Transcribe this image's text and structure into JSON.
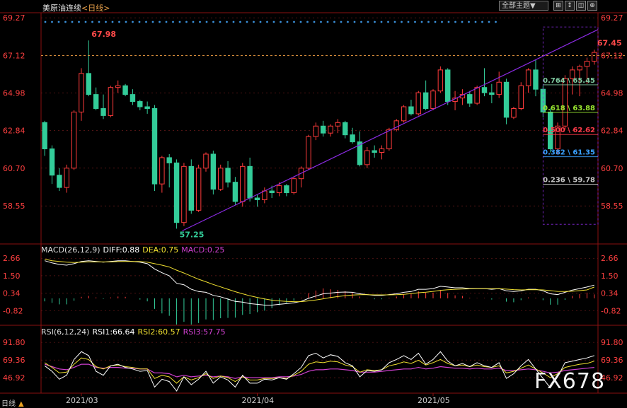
{
  "header": {
    "instrument": "美原油连续",
    "period": "<日线>",
    "theme_button": "全部主题▼",
    "tool_buttons": [
      "⊞",
      "↕",
      "◫",
      "⊕"
    ]
  },
  "colors": {
    "up": "#ff3b3b",
    "down": "#33cc99",
    "gridline": "#802020",
    "trend": "#8a2be2",
    "macd_diff": "#ffffff",
    "macd_dea": "#f0e030",
    "rsi1": "#ffffff",
    "rsi2": "#f0e030",
    "rsi3": "#d040d0",
    "axis_text": "#ff4040",
    "dot_row": "#3a8fd8"
  },
  "macd": {
    "label": "MACD(26,12,9)",
    "diff": "DIFF:0.88",
    "dea": "DEA:0.75",
    "macd": "MACD:0.25"
  },
  "rsi": {
    "label": "RSI(6,12,24)",
    "rsi1": "RSI1:66.64",
    "rsi2": "RSI2:60.57",
    "rsi3": "RSI3:57.75"
  },
  "bottom": {
    "side_label": "日线",
    "watermark": "FX678"
  },
  "chart_data": {
    "type": "candlestick",
    "x_labels": [
      "2021/03",
      "2021/04",
      "2021/05"
    ],
    "price_axis": [
      "69.27",
      "67.12",
      "64.98",
      "62.84",
      "60.70",
      "58.55"
    ],
    "ylim": [
      56.5,
      69.4
    ],
    "current_price": 67.12,
    "high_marker": {
      "label": "67.98",
      "value": 67.98
    },
    "low_marker": {
      "label": "57.25",
      "value": 57.25
    },
    "last_marker": {
      "label": "67.45",
      "value": 67.45
    },
    "fib_levels": [
      {
        "label": "0.764 \\ 65.45",
        "value": 65.45,
        "color": "#7fc9a0"
      },
      {
        "label": "0.618 \\ 63.88",
        "value": 63.88,
        "color": "#9be830"
      },
      {
        "label": "0.500 \\ 62.62",
        "value": 62.62,
        "color": "#ff3b4a"
      },
      {
        "label": "0.382 \\ 61.35",
        "value": 61.35,
        "color": "#3aa0ff"
      },
      {
        "label": "0.236 \\ 59.78",
        "value": 59.78,
        "color": "#c8c8c8"
      }
    ],
    "candles": [
      [
        63.3,
        63.4,
        61.4,
        61.8
      ],
      [
        61.8,
        62.0,
        59.8,
        60.3
      ],
      [
        60.3,
        60.7,
        59.4,
        59.6
      ],
      [
        59.6,
        60.9,
        59.3,
        60.7
      ],
      [
        60.7,
        64.0,
        60.6,
        63.9
      ],
      [
        63.9,
        66.4,
        63.4,
        66.1
      ],
      [
        66.1,
        67.98,
        64.8,
        64.9
      ],
      [
        64.9,
        65.3,
        64.0,
        64.1
      ],
      [
        64.1,
        64.9,
        63.5,
        63.7
      ],
      [
        63.7,
        65.4,
        63.6,
        65.3
      ],
      [
        65.3,
        65.7,
        65.0,
        65.4
      ],
      [
        65.4,
        65.5,
        64.8,
        64.9
      ],
      [
        64.9,
        65.2,
        64.3,
        64.5
      ],
      [
        64.5,
        64.6,
        64.0,
        64.2
      ],
      [
        64.2,
        64.5,
        63.8,
        64.1
      ],
      [
        64.1,
        64.3,
        59.4,
        59.8
      ],
      [
        59.8,
        61.4,
        59.3,
        61.3
      ],
      [
        61.3,
        61.5,
        59.6,
        61.0
      ],
      [
        61.0,
        61.2,
        57.25,
        57.6
      ],
      [
        57.6,
        61.0,
        57.4,
        60.8
      ],
      [
        60.8,
        61.2,
        58.1,
        58.3
      ],
      [
        58.3,
        60.9,
        58.2,
        60.7
      ],
      [
        60.7,
        61.6,
        60.5,
        61.5
      ],
      [
        61.5,
        61.7,
        59.2,
        59.5
      ],
      [
        59.5,
        60.9,
        59.4,
        60.7
      ],
      [
        60.7,
        61.1,
        59.6,
        59.9
      ],
      [
        59.9,
        60.2,
        58.6,
        58.8
      ],
      [
        58.8,
        61.0,
        58.5,
        60.8
      ],
      [
        60.8,
        61.3,
        58.8,
        59.0
      ],
      [
        59.0,
        59.2,
        58.5,
        58.9
      ],
      [
        58.9,
        59.6,
        58.7,
        59.4
      ],
      [
        59.4,
        59.7,
        59.0,
        59.3
      ],
      [
        59.3,
        59.9,
        59.1,
        59.7
      ],
      [
        59.7,
        59.8,
        59.1,
        59.3
      ],
      [
        59.3,
        60.2,
        59.2,
        60.1
      ],
      [
        60.1,
        60.8,
        59.6,
        60.7
      ],
      [
        60.7,
        62.6,
        60.6,
        62.5
      ],
      [
        62.5,
        63.3,
        62.3,
        63.1
      ],
      [
        63.1,
        63.4,
        62.5,
        62.7
      ],
      [
        62.7,
        63.2,
        62.5,
        63.1
      ],
      [
        63.1,
        63.5,
        62.7,
        63.3
      ],
      [
        63.3,
        63.4,
        62.4,
        62.6
      ],
      [
        62.6,
        63.0,
        62.1,
        62.2
      ],
      [
        62.2,
        62.8,
        60.8,
        60.9
      ],
      [
        60.9,
        61.9,
        60.7,
        61.7
      ],
      [
        61.7,
        62.0,
        61.3,
        61.6
      ],
      [
        61.6,
        62.0,
        61.2,
        61.8
      ],
      [
        61.8,
        63.0,
        61.7,
        62.9
      ],
      [
        62.9,
        63.5,
        62.8,
        63.4
      ],
      [
        63.4,
        64.3,
        63.3,
        64.2
      ],
      [
        64.2,
        64.6,
        63.7,
        63.8
      ],
      [
        63.8,
        65.1,
        63.7,
        65.0
      ],
      [
        65.0,
        65.7,
        64.0,
        64.1
      ],
      [
        64.1,
        65.2,
        64.0,
        65.1
      ],
      [
        65.1,
        66.5,
        65.0,
        66.3
      ],
      [
        66.3,
        66.4,
        64.3,
        64.5
      ],
      [
        64.5,
        65.1,
        64.0,
        64.7
      ],
      [
        64.7,
        65.2,
        64.3,
        64.9
      ],
      [
        64.9,
        65.1,
        64.2,
        64.4
      ],
      [
        64.4,
        65.4,
        64.3,
        65.3
      ],
      [
        65.3,
        66.4,
        64.8,
        65.0
      ],
      [
        65.0,
        65.5,
        64.4,
        64.9
      ],
      [
        64.9,
        66.2,
        64.7,
        65.6
      ],
      [
        65.6,
        65.8,
        63.2,
        63.6
      ],
      [
        63.6,
        64.2,
        63.5,
        64.1
      ],
      [
        64.1,
        65.6,
        64.0,
        65.4
      ],
      [
        65.4,
        66.4,
        65.0,
        66.3
      ],
      [
        66.3,
        66.9,
        64.8,
        65.2
      ],
      [
        65.2,
        65.4,
        63.6,
        63.9
      ],
      [
        63.9,
        64.1,
        61.6,
        61.8
      ],
      [
        61.8,
        63.3,
        61.5,
        63.1
      ],
      [
        63.1,
        66.0,
        62.9,
        65.8
      ],
      [
        65.8,
        66.5,
        64.9,
        66.3
      ],
      [
        66.3,
        66.6,
        64.8,
        66.5
      ],
      [
        66.5,
        67.0,
        65.5,
        66.8
      ],
      [
        66.8,
        67.45,
        66.6,
        67.3
      ]
    ],
    "macd_axis": [
      "2.66",
      "1.50",
      "0.34",
      "-0.82"
    ],
    "macd_ylim": [
      -1.6,
      3.0
    ],
    "macd_diff": [
      2.5,
      2.35,
      2.25,
      2.2,
      2.3,
      2.45,
      2.5,
      2.45,
      2.4,
      2.45,
      2.5,
      2.5,
      2.45,
      2.4,
      2.3,
      1.95,
      1.7,
      1.5,
      1.0,
      0.9,
      0.6,
      0.45,
      0.4,
      0.2,
      0.1,
      -0.05,
      -0.2,
      -0.25,
      -0.35,
      -0.4,
      -0.45,
      -0.45,
      -0.4,
      -0.35,
      -0.3,
      -0.2,
      0.0,
      0.15,
      0.3,
      0.35,
      0.4,
      0.42,
      0.4,
      0.3,
      0.25,
      0.2,
      0.2,
      0.25,
      0.3,
      0.4,
      0.45,
      0.6,
      0.6,
      0.65,
      0.8,
      0.75,
      0.7,
      0.7,
      0.65,
      0.65,
      0.65,
      0.6,
      0.65,
      0.5,
      0.45,
      0.5,
      0.6,
      0.6,
      0.5,
      0.3,
      0.25,
      0.4,
      0.55,
      0.65,
      0.75,
      0.88
    ],
    "macd_dea": [
      2.6,
      2.5,
      2.45,
      2.4,
      2.38,
      2.4,
      2.42,
      2.42,
      2.42,
      2.42,
      2.44,
      2.45,
      2.45,
      2.44,
      2.4,
      2.3,
      2.2,
      2.08,
      1.87,
      1.68,
      1.47,
      1.27,
      1.1,
      0.92,
      0.76,
      0.6,
      0.44,
      0.3,
      0.17,
      0.06,
      -0.04,
      -0.12,
      -0.17,
      -0.2,
      -0.22,
      -0.22,
      -0.17,
      -0.11,
      -0.03,
      0.05,
      0.12,
      0.18,
      0.22,
      0.24,
      0.24,
      0.23,
      0.23,
      0.23,
      0.24,
      0.27,
      0.31,
      0.37,
      0.41,
      0.46,
      0.53,
      0.57,
      0.6,
      0.62,
      0.63,
      0.64,
      0.64,
      0.64,
      0.64,
      0.61,
      0.58,
      0.56,
      0.57,
      0.58,
      0.56,
      0.51,
      0.46,
      0.45,
      0.47,
      0.51,
      0.56,
      0.75
    ],
    "rsi_axis": [
      "91.80",
      "69.36",
      "46.92"
    ],
    "rsi_ylim": [
      30,
      100
    ],
    "rsi1": [
      62,
      55,
      45,
      50,
      70,
      80,
      75,
      55,
      50,
      62,
      64,
      60,
      58,
      55,
      56,
      35,
      45,
      42,
      30,
      48,
      38,
      45,
      55,
      40,
      48,
      44,
      35,
      50,
      40,
      40,
      45,
      44,
      47,
      45,
      52,
      60,
      75,
      78,
      72,
      76,
      74,
      66,
      62,
      48,
      56,
      55,
      57,
      66,
      70,
      75,
      70,
      78,
      64,
      70,
      80,
      68,
      62,
      65,
      61,
      66,
      62,
      60,
      66,
      46,
      52,
      62,
      70,
      58,
      46,
      34,
      48,
      66,
      68,
      70,
      72,
      75
    ],
    "rsi2": [
      66,
      60,
      53,
      54,
      64,
      72,
      70,
      61,
      58,
      62,
      63,
      61,
      60,
      58,
      58,
      46,
      50,
      48,
      40,
      48,
      44,
      47,
      52,
      46,
      49,
      47,
      42,
      48,
      44,
      44,
      46,
      46,
      47,
      46,
      50,
      55,
      64,
      67,
      66,
      68,
      67,
      63,
      61,
      54,
      57,
      56,
      57,
      62,
      64,
      67,
      65,
      69,
      63,
      66,
      70,
      65,
      62,
      63,
      61,
      63,
      61,
      60,
      62,
      53,
      55,
      59,
      63,
      58,
      53,
      47,
      52,
      60,
      62,
      64,
      65,
      68
    ],
    "rsi3": [
      64,
      61,
      58,
      57,
      60,
      64,
      64,
      60,
      59,
      60,
      60,
      59,
      59,
      58,
      58,
      53,
      53,
      52,
      48,
      50,
      48,
      49,
      50,
      48,
      49,
      48,
      46,
      48,
      47,
      47,
      47,
      47,
      48,
      48,
      49,
      51,
      55,
      57,
      57,
      58,
      58,
      57,
      56,
      54,
      54,
      54,
      55,
      56,
      57,
      58,
      58,
      60,
      58,
      59,
      61,
      60,
      59,
      59,
      58,
      59,
      58,
      58,
      59,
      56,
      56,
      57,
      58,
      57,
      55,
      53,
      54,
      56,
      57,
      58,
      59,
      60
    ]
  }
}
